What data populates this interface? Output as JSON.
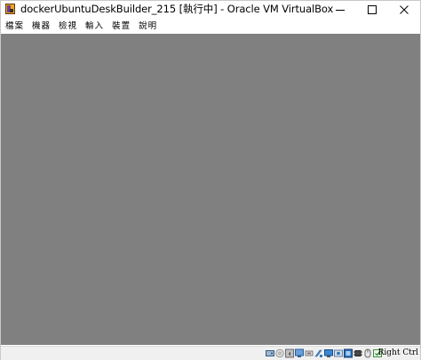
{
  "window": {
    "title": "dockerUbuntuDeskBuilder_215 [執行中] - Oracle VM VirtualBox",
    "app_icon": "virtualbox-icon",
    "controls": [
      "minimize-icon",
      "maximize-icon",
      "close-icon"
    ]
  },
  "menu": {
    "items": [
      {
        "label": "檔案"
      },
      {
        "label": "機器"
      },
      {
        "label": "檢視"
      },
      {
        "label": "輸入"
      },
      {
        "label": "裝置"
      },
      {
        "label": "說明"
      }
    ]
  },
  "vm_display": {
    "background": "#808080"
  },
  "statusbar": {
    "icons": [
      "hard-disk-icon",
      "optical-drive-icon",
      "audio-icon",
      "network-icon",
      "usb-icon",
      "shared-folders-icon",
      "display-icon",
      "video-capture-icon",
      "virtualization-engine-icon",
      "cpu-icon",
      "mouse-integration-icon",
      "keyboard-capture-icon"
    ],
    "host_key": "Right Ctrl"
  }
}
